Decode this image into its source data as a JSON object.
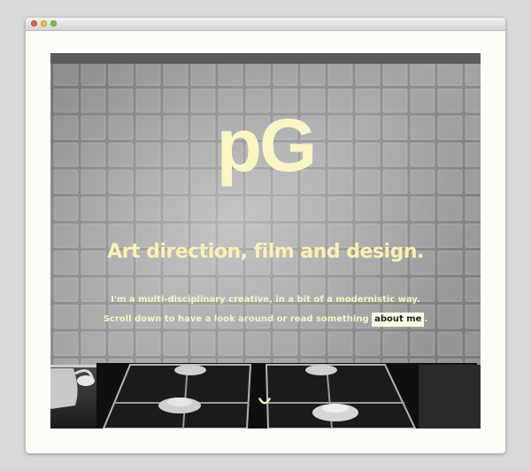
{
  "site": {
    "logo": "pG",
    "tagline": "Art direction, film and design.",
    "intro_line1": "I'm a multi-disciplinary creative, in a bit of a modernistic way.",
    "intro_line2": "Scroll down to have a look around or read something",
    "about_link": "about me",
    "intro_end": "."
  },
  "colors": {
    "accent_text": "#fbf0b4",
    "link_bg": "#fdfbe6"
  },
  "icons": {
    "scroll": "scroll-down-arc-icon"
  }
}
